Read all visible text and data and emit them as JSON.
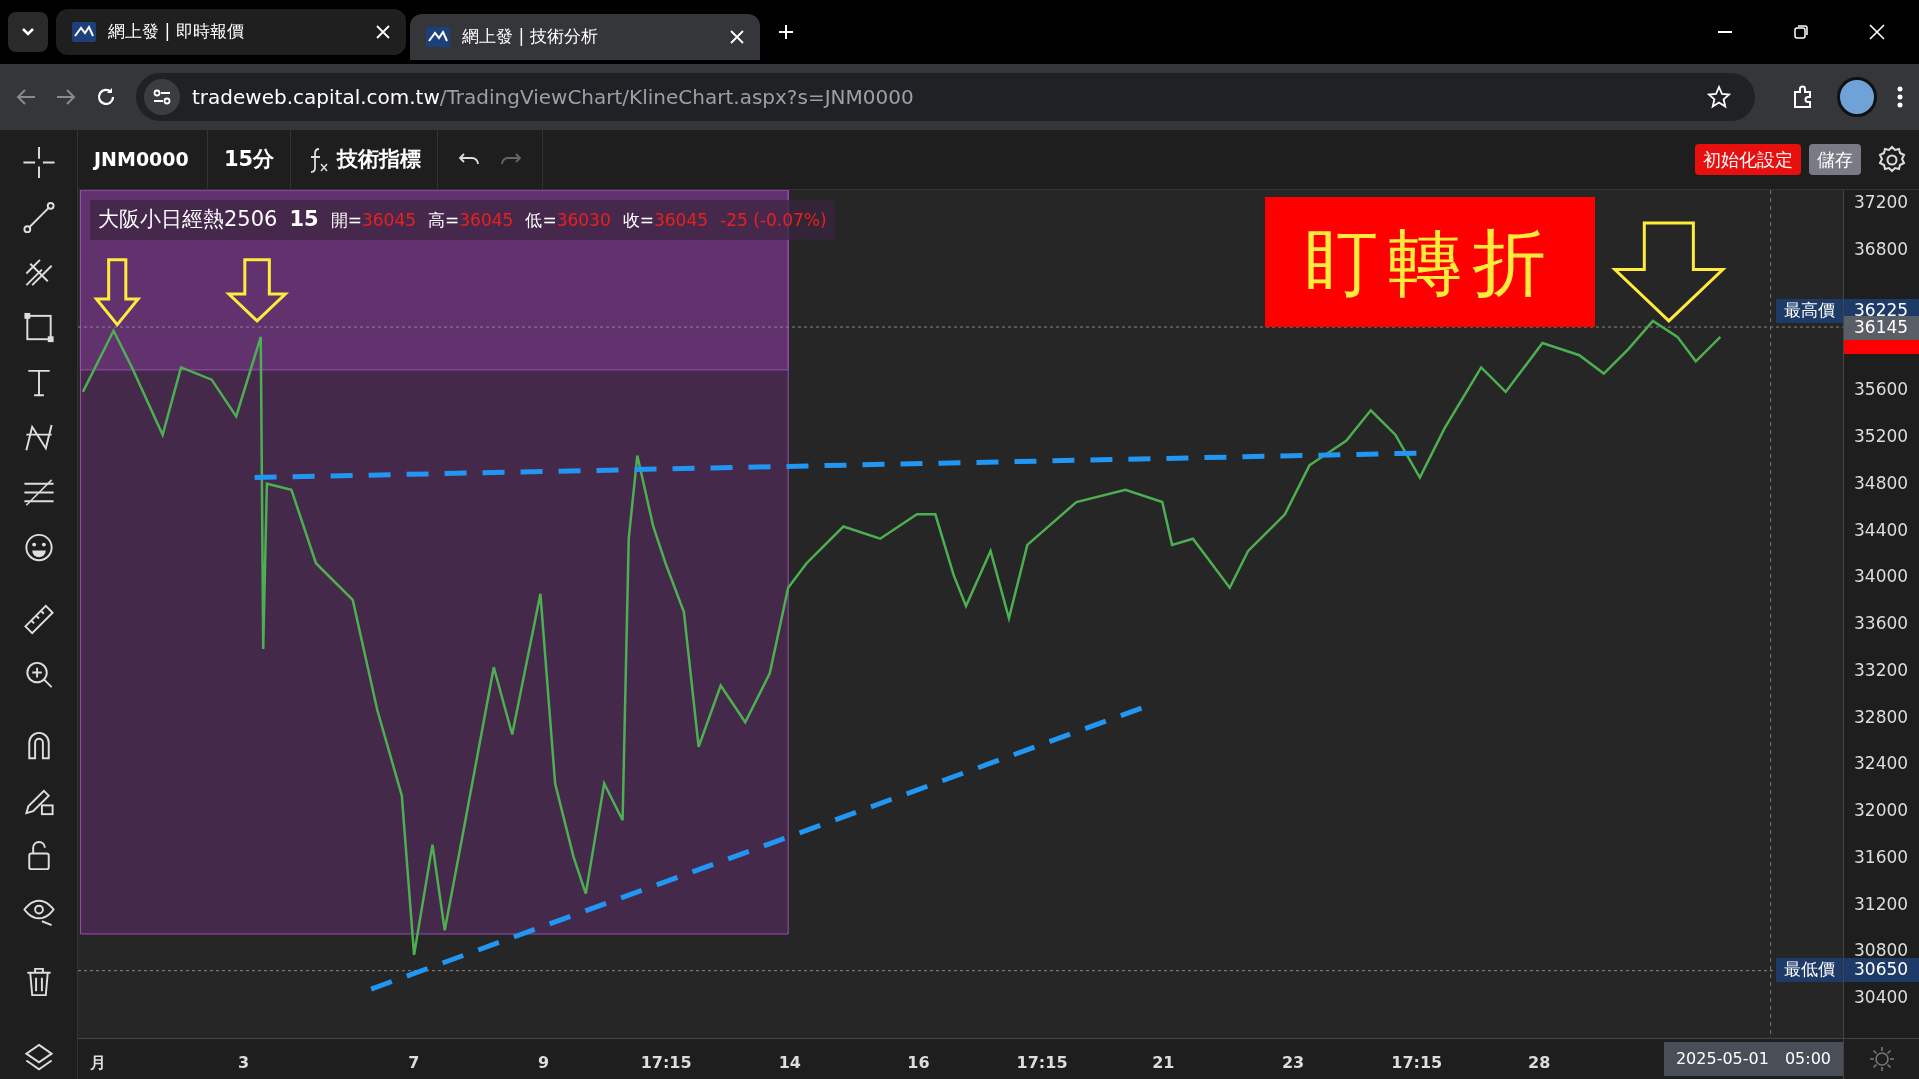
{
  "browser": {
    "tabs": [
      {
        "title": "網上發 | 即時報價",
        "selected": false
      },
      {
        "title": "網上發 | 技術分析",
        "selected": true
      }
    ],
    "url_host": "tradeweb.capital.com.tw",
    "url_path": "/TradingViewChart/KlineChart.aspx?s=JNM0000"
  },
  "toolbar": {
    "symbol": "JNM0000",
    "interval": "15分",
    "indicators": "技術指標",
    "reset_button": "初始化設定",
    "save_button": "儲存"
  },
  "legend": {
    "name": "大阪小日經熱2506",
    "interval": "15",
    "fields": [
      {
        "label": "開=",
        "value": "36045"
      },
      {
        "label": "高=",
        "value": "36045"
      },
      {
        "label": "低=",
        "value": "36030"
      },
      {
        "label": "收=",
        "value": "36045"
      }
    ],
    "change": "-25 (-0.07%)"
  },
  "annotation": "盯轉折",
  "price_axis": {
    "ticks": [
      "37200",
      "36800",
      "35600",
      "35200",
      "34800",
      "34400",
      "34000",
      "33600",
      "33200",
      "32800",
      "32400",
      "32000",
      "31600",
      "31200",
      "30800",
      "30400"
    ],
    "high_label": "最高價",
    "high_value": "36225",
    "last_value": "36145",
    "low_label": "最低價",
    "low_value": "30650"
  },
  "time_axis": {
    "labels": [
      "月",
      "3",
      "7",
      "9",
      "17:15",
      "14",
      "16",
      "17:15",
      "21",
      "23",
      "17:15",
      "28"
    ],
    "cursor_date": "2025-05-01",
    "cursor_time": "05:00"
  }
}
